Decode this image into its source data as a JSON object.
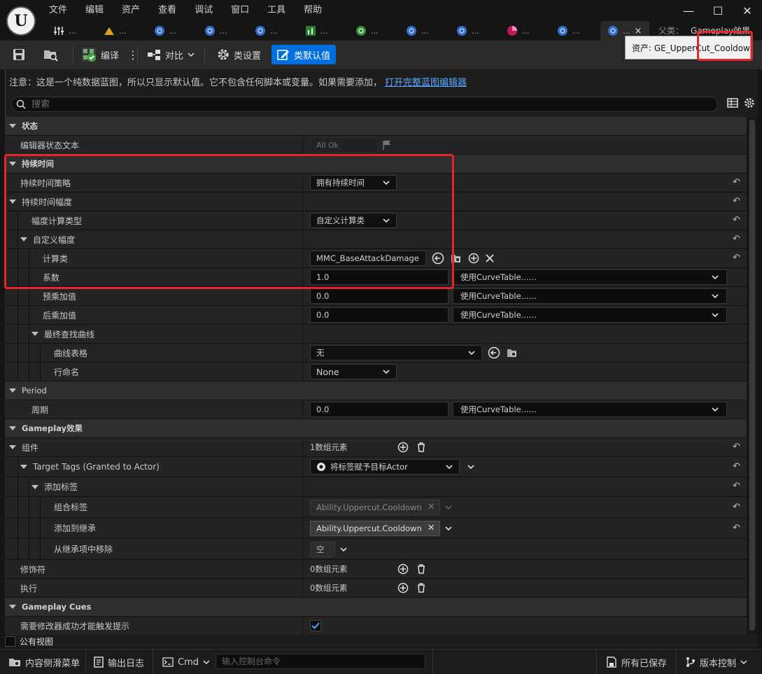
{
  "menu": [
    "文件",
    "编辑",
    "资产",
    "查看",
    "调试",
    "窗口",
    "工具",
    "帮助"
  ],
  "tabs": [
    {
      "icon": "sliders-icon",
      "label": "..."
    },
    {
      "icon": "material-icon",
      "label": "..."
    },
    {
      "icon": "blueprint-icon",
      "label": "..."
    },
    {
      "icon": "blueprint-icon",
      "label": "..."
    },
    {
      "icon": "blueprint-icon",
      "label": "..."
    },
    {
      "icon": "chart-asset-icon",
      "label": "..."
    },
    {
      "icon": "globe-icon",
      "label": "..."
    },
    {
      "icon": "blueprint-icon",
      "label": "..."
    },
    {
      "icon": "blueprint-icon",
      "label": "..."
    },
    {
      "icon": "pie-asset-icon",
      "label": "..."
    },
    {
      "icon": "blueprint-icon",
      "label": "..."
    },
    {
      "icon": "blueprint-icon",
      "label": "...",
      "close": "×"
    }
  ],
  "parent": {
    "label": "父类：",
    "value": "Gameplay效果"
  },
  "toolbar": {
    "compile": "编译",
    "diff": "对比",
    "class_settings": "类设置",
    "class_defaults": "类默认值"
  },
  "tooltip": "资产: GE_UpperCut_Cooldown",
  "notice": {
    "text": "注意：这是一个纯数据蓝图，所以只显示默认值。它不包含任何脚本或变量。如果需要添加，",
    "link": "打开完整蓝图编辑器"
  },
  "search": {
    "placeholder": "搜索"
  },
  "grid": {
    "status_cat": "状态",
    "editor_status_label": "编辑器状态文本",
    "editor_status_value": "All Ok",
    "duration_cat": "持续时间",
    "duration_policy_label": "持续时间策略",
    "duration_policy_value": "拥有持续时间",
    "duration_magnitude_label": "持续时间幅度",
    "magnitude_calc_type_label": "幅度计算类型",
    "magnitude_calc_type_value": "自定义计算类",
    "custom_magnitude_label": "自定义幅度",
    "calc_class_label": "计算类",
    "calc_class_value": "MMC_BaseAttackDamage",
    "coefficient_label": "系数",
    "coefficient_value": "1.0",
    "curve_table_hint": "使用CurveTable......",
    "pre_mult_label": "预乘加值",
    "pre_mult_value": "0.0",
    "post_mult_label": "后乘加值",
    "post_mult_value": "0.0",
    "final_lookup_label": "最终查找曲线",
    "curve_table_label": "曲线表格",
    "curve_table_value": "无",
    "row_name_label": "行命名",
    "row_name_value": "None",
    "period_cat": "Period",
    "period_label": "周期",
    "period_value": "0.0",
    "gameplay_effect_cat": "Gameplay效果",
    "components_label": "组件",
    "components_value": "1数组元素",
    "target_tags_label": "Target Tags (Granted to Actor)",
    "target_tags_value": "将标签赋予目标Actor",
    "add_tags_label": "添加标签",
    "combined_tags_label": "组合标签",
    "combined_tags_value": "Ability.Uppercut.Cooldown",
    "add_to_inherited_label": "添加到继承",
    "add_to_inherited_value": "Ability.Uppercut.Cooldown",
    "remove_from_inherited_label": "从继承项中移除",
    "remove_from_inherited_value": "空",
    "modifiers_label": "修饰符",
    "modifiers_value": "0数组元素",
    "executions_label": "执行",
    "executions_value": "0数组元素",
    "cues_cat": "Gameplay Cues",
    "require_modifier_label": "需要修改器成功才能触发提示"
  },
  "public_view": "公有视图",
  "statusbar": {
    "content_drawer": "内容侧滑菜单",
    "output_log": "输出日志",
    "cmd": "Cmd",
    "cmd_placeholder": "输入控制台命令",
    "all_saved": "所有已保存",
    "source_control": "版本控制"
  },
  "colors": {
    "accent": "#0070e0",
    "highlight": "#e8242b",
    "link": "#5aa8ff"
  }
}
